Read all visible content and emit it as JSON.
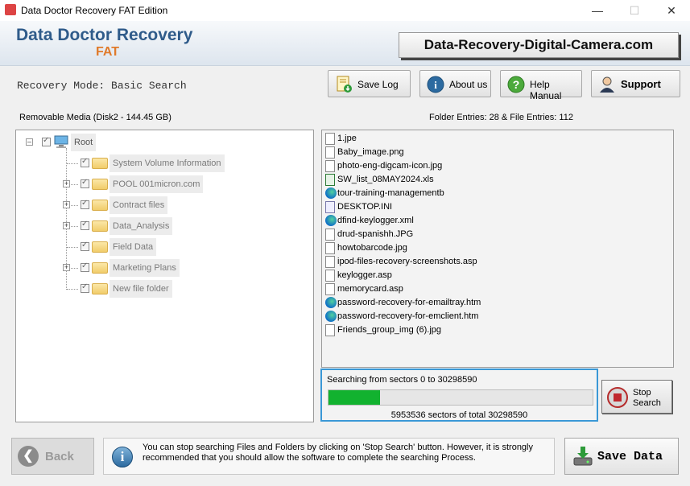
{
  "window": {
    "title": "Data Doctor Recovery FAT Edition",
    "minimize": "—",
    "maximize": "☐",
    "close": "✕"
  },
  "header": {
    "brand": "Data Doctor Recovery",
    "brand_sub": "FAT",
    "site": "Data-Recovery-Digital-Camera.com"
  },
  "mode": "Recovery Mode: Basic Search",
  "toolbar": {
    "save_log": "Save Log",
    "about_us": "About us",
    "help_manual": "Help Manual",
    "support": "Support"
  },
  "media_label": "Removable Media (Disk2 - 144.45 GB)",
  "entries_label": "Folder Entries: 28 & File Entries: 112",
  "tree": {
    "root": "Root",
    "items": [
      {
        "label": "System Volume Information",
        "expandable": false
      },
      {
        "label": "POOL 001micron.com",
        "expandable": true
      },
      {
        "label": "Contract files",
        "expandable": true
      },
      {
        "label": "Data_Analysis",
        "expandable": true
      },
      {
        "label": "Field Data",
        "expandable": false
      },
      {
        "label": "Marketing Plans",
        "expandable": true
      },
      {
        "label": "New file folder",
        "expandable": false
      }
    ]
  },
  "files": [
    {
      "name": "1.jpe",
      "icon": "file-icon"
    },
    {
      "name": "Baby_image.png",
      "icon": "file-icon"
    },
    {
      "name": "photo-eng-digcam-icon.jpg",
      "icon": "file-icon"
    },
    {
      "name": "SW_list_08MAY2024.xls",
      "icon": "excel-icon"
    },
    {
      "name": "tour-training-managementb",
      "icon": "edge-icon"
    },
    {
      "name": "DESKTOP.INI",
      "icon": "settings-file-icon"
    },
    {
      "name": "dfind-keylogger.xml",
      "icon": "edge-icon"
    },
    {
      "name": "drud-spanishh.JPG",
      "icon": "file-icon"
    },
    {
      "name": "howtobarcode.jpg",
      "icon": "file-icon"
    },
    {
      "name": "ipod-files-recovery-screenshots.asp",
      "icon": "file-icon"
    },
    {
      "name": "keylogger.asp",
      "icon": "file-icon"
    },
    {
      "name": "memorycard.asp",
      "icon": "file-icon"
    },
    {
      "name": "password-recovery-for-emailtray.htm",
      "icon": "edge-icon"
    },
    {
      "name": "password-recovery-for-emclient.htm",
      "icon": "edge-icon"
    },
    {
      "name": "Friends_group_img (6).jpg",
      "icon": "file-icon"
    }
  ],
  "progress": {
    "text": "Searching from sectors    0 to 30298590",
    "fraction": 0.196,
    "count_text": "5953536   sectors  of  total 30298590"
  },
  "stop_button": {
    "line1": "Stop",
    "line2": "Search"
  },
  "back_button": "Back",
  "info_text": "You can stop searching Files and Folders by clicking on 'Stop Search' button. However, it is strongly recommended that you should allow the software to complete the searching Process.",
  "save_button": "Save Data"
}
